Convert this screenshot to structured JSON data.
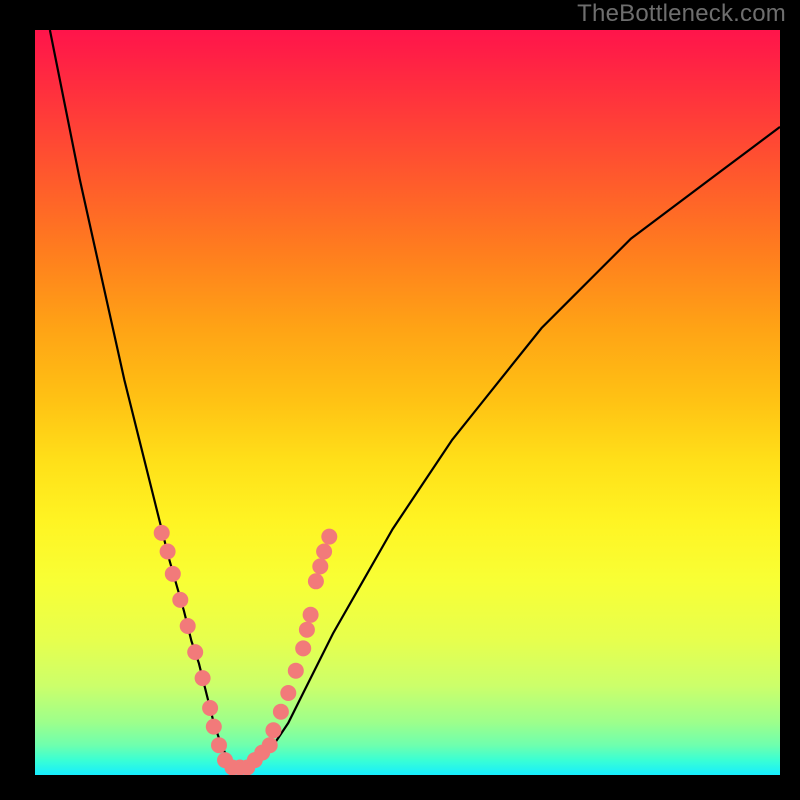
{
  "watermark": "TheBottleneck.com",
  "colors": {
    "curve": "#000000",
    "dot_fill": "#f27a7a",
    "dot_stroke": "#c95555"
  },
  "chart_data": {
    "type": "line",
    "title": "",
    "xlabel": "",
    "ylabel": "",
    "xlim": [
      0,
      100
    ],
    "ylim": [
      0,
      100
    ],
    "series": [
      {
        "name": "curve",
        "x": [
          2,
          4,
          6,
          8,
          10,
          12,
          14,
          16,
          18,
          20,
          21,
          22,
          23,
          24,
          25,
          26,
          27,
          28,
          29,
          30,
          32,
          34,
          36,
          38,
          40,
          44,
          48,
          52,
          56,
          60,
          64,
          68,
          72,
          76,
          80,
          84,
          88,
          92,
          96,
          100
        ],
        "y": [
          100,
          90,
          80,
          71,
          62,
          53,
          45,
          37,
          29,
          22,
          18,
          15,
          11,
          7,
          4,
          2,
          1,
          1,
          1,
          2,
          4,
          7,
          11,
          15,
          19,
          26,
          33,
          39,
          45,
          50,
          55,
          60,
          64,
          68,
          72,
          75,
          78,
          81,
          84,
          87
        ]
      }
    ],
    "dots": [
      {
        "x": 17.0,
        "y": 32.5
      },
      {
        "x": 17.8,
        "y": 30.0
      },
      {
        "x": 18.5,
        "y": 27.0
      },
      {
        "x": 19.5,
        "y": 23.5
      },
      {
        "x": 20.5,
        "y": 20.0
      },
      {
        "x": 21.5,
        "y": 16.5
      },
      {
        "x": 22.5,
        "y": 13.0
      },
      {
        "x": 23.5,
        "y": 9.0
      },
      {
        "x": 24.0,
        "y": 6.5
      },
      {
        "x": 24.7,
        "y": 4.0
      },
      {
        "x": 25.5,
        "y": 2.0
      },
      {
        "x": 26.5,
        "y": 1.0
      },
      {
        "x": 27.5,
        "y": 1.0
      },
      {
        "x": 28.5,
        "y": 1.0
      },
      {
        "x": 29.5,
        "y": 2.0
      },
      {
        "x": 30.5,
        "y": 3.0
      },
      {
        "x": 31.5,
        "y": 4.0
      },
      {
        "x": 32.0,
        "y": 6.0
      },
      {
        "x": 33.0,
        "y": 8.5
      },
      {
        "x": 34.0,
        "y": 11.0
      },
      {
        "x": 35.0,
        "y": 14.0
      },
      {
        "x": 36.0,
        "y": 17.0
      },
      {
        "x": 36.5,
        "y": 19.5
      },
      {
        "x": 37.0,
        "y": 21.5
      },
      {
        "x": 37.7,
        "y": 26.0
      },
      {
        "x": 38.3,
        "y": 28.0
      },
      {
        "x": 38.8,
        "y": 30.0
      },
      {
        "x": 39.5,
        "y": 32.0
      }
    ]
  }
}
